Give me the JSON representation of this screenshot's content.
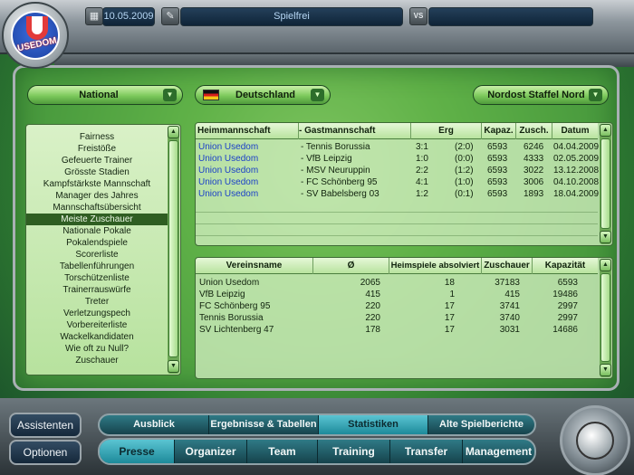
{
  "logo": {
    "text": "USEDOM"
  },
  "topbar": {
    "calendar_icon": "calendar-icon",
    "date": "10.05.2009",
    "settings_icon": "settings-icon",
    "match_title": "Spielfrei",
    "vs_label": "VS",
    "opponent": ""
  },
  "dropdowns": {
    "league": "National",
    "country": "Deutschland",
    "division": "Nordost Staffel Nord"
  },
  "stats_list": {
    "items": [
      "Fairness",
      "Freistöße",
      "Gefeuerte Trainer",
      "Grösste Stadien",
      "Kampfstärkste Mannschaft",
      "Manager des Jahres",
      "Mannschaftsübersicht",
      "Meiste Zuschauer",
      "Nationale Pokale",
      "Pokalendspiele",
      "Scorerliste",
      "Tabellenführungen",
      "Torschützenliste",
      "Trainerrauswürfe",
      "Treter",
      "Verletzungspech",
      "Vorbereiterliste",
      "Wackelkandidaten",
      "Wie oft zu Null?",
      "Zuschauer"
    ],
    "selected": "Meiste Zuschauer"
  },
  "matches": {
    "headers": {
      "home": "Heimmannschaft",
      "away": "- Gastmannschaft",
      "result": "Erg",
      "capacity": "Kapaz.",
      "attendance": "Zusch.",
      "date": "Datum"
    },
    "rows": [
      {
        "home": "Union Usedom",
        "away": "- Tennis Borussia",
        "score": "3:1",
        "half": "(2:0)",
        "capacity": "6593",
        "attendance": "6246",
        "date": "04.04.2009"
      },
      {
        "home": "Union Usedom",
        "away": "- VfB Leipzig",
        "score": "1:0",
        "half": "(0:0)",
        "capacity": "6593",
        "attendance": "4333",
        "date": "02.05.2009"
      },
      {
        "home": "Union Usedom",
        "away": "- MSV Neuruppin",
        "score": "2:2",
        "half": "(1:2)",
        "capacity": "6593",
        "attendance": "3022",
        "date": "13.12.2008"
      },
      {
        "home": "Union Usedom",
        "away": "- FC Schönberg 95",
        "score": "4:1",
        "half": "(1:0)",
        "capacity": "6593",
        "attendance": "3006",
        "date": "04.10.2008"
      },
      {
        "home": "Union Usedom",
        "away": "- SV Babelsberg 03",
        "score": "1:2",
        "half": "(0:1)",
        "capacity": "6593",
        "attendance": "1893",
        "date": "18.04.2009"
      }
    ]
  },
  "clubs": {
    "headers": {
      "name": "Vereinsname",
      "avg": "Ø",
      "home_games": "Heimspiele absolviert",
      "attendance": "Zuschauer",
      "capacity": "Kapazität"
    },
    "rows": [
      {
        "name": "Union Usedom",
        "avg": "2065",
        "home_games": "18",
        "attendance": "37183",
        "capacity": "6593"
      },
      {
        "name": "VfB Leipzig",
        "avg": "415",
        "home_games": "1",
        "attendance": "415",
        "capacity": "19486"
      },
      {
        "name": "FC Schönberg 95",
        "avg": "220",
        "home_games": "17",
        "attendance": "3741",
        "capacity": "2997"
      },
      {
        "name": "Tennis Borussia",
        "avg": "220",
        "home_games": "17",
        "attendance": "3740",
        "capacity": "2997"
      },
      {
        "name": "SV Lichtenberg 47",
        "avg": "178",
        "home_games": "17",
        "attendance": "3031",
        "capacity": "14686"
      }
    ]
  },
  "left_buttons": {
    "assistants": "Assistenten",
    "options": "Optionen"
  },
  "tabs_top": [
    "Ausblick",
    "Ergebnisse & Tabellen",
    "Statistiken",
    "Alte Spielberichte"
  ],
  "tabs_top_active": "Statistiken",
  "tabs_bottom": [
    "Presse",
    "Organizer",
    "Team",
    "Training",
    "Transfer",
    "Management"
  ],
  "tabs_bottom_active": "Presse",
  "colors": {
    "accent": "#5ac4d2",
    "panel_green": "#60b448",
    "link_blue": "#1a3fc8"
  }
}
